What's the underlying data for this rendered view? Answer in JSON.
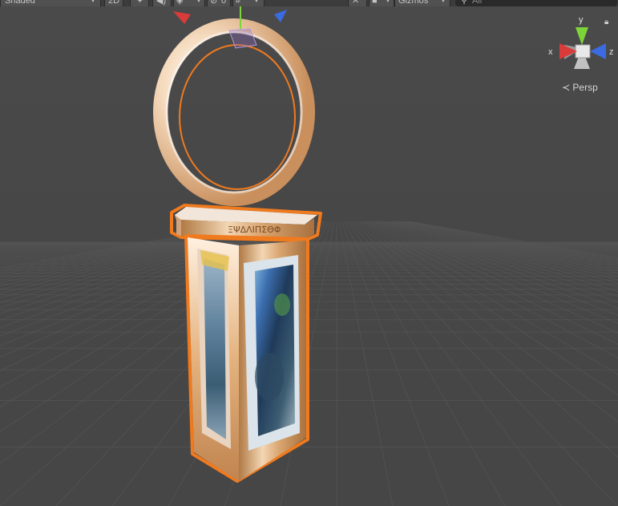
{
  "toolbar": {
    "shading_mode": "Shaded",
    "mode_2d": "2D",
    "audio_icon": "speaker-icon",
    "effects_icon": "layers-icon",
    "hidden_count": "0",
    "grid_icon": "grid-snap-icon",
    "tools_icon": "crossed-tools-icon",
    "camera_icon": "camera-icon",
    "gizmos_label": "Gizmos",
    "search_placeholder": "All"
  },
  "scene_gizmo": {
    "y_label": "y",
    "x_label": "x",
    "z_label": "z",
    "projection_label": "Persp",
    "colors": {
      "x": "#d93a3a",
      "y": "#7dd43a",
      "z": "#3b6be0"
    }
  },
  "selection": {
    "outline_color": "#f07a1e",
    "object_name": "gold pendant with ring and glass panels",
    "engraving": "ΞΨΔΛΙΠΣΘΦ"
  }
}
